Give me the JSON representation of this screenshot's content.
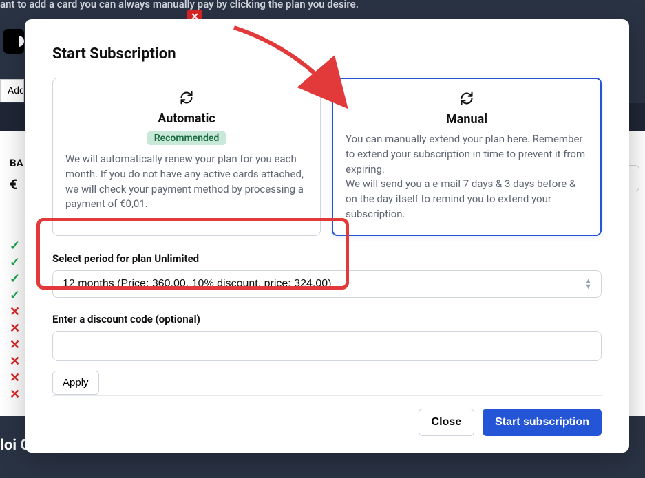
{
  "background": {
    "top_text": "ant to add a card you can always manually pay by clicking the plan you desire.",
    "add_label": "Add",
    "ba_label": "BA",
    "euro_label": "€",
    "footer_title": "loi Core"
  },
  "modal": {
    "title": "Start Subscription",
    "automatic": {
      "title": "Automatic",
      "badge": "Recommended",
      "desc": "We will automatically renew your plan for you each month. If you do not have any active cards attached, we will check your payment method by processing a payment of €0,01."
    },
    "manual": {
      "title": "Manual",
      "desc": "You can manually extend your plan here. Remember to extend your subscription in time to prevent it from expiring.\nWe will send you a e-mail 7 days & 3 days before & on the day itself to remind you to extend your subscription."
    },
    "period_label": "Select period for plan Unlimited",
    "period_value": "12 months (Price: 360.00, 10% discount, price: 324.00)",
    "discount_label": "Enter a discount code (optional)",
    "discount_value": "",
    "apply_label": "Apply",
    "close_label": "Close",
    "start_label": "Start subscription"
  },
  "colors": {
    "primary": "#2455d6",
    "highlight": "#e23a3a"
  }
}
